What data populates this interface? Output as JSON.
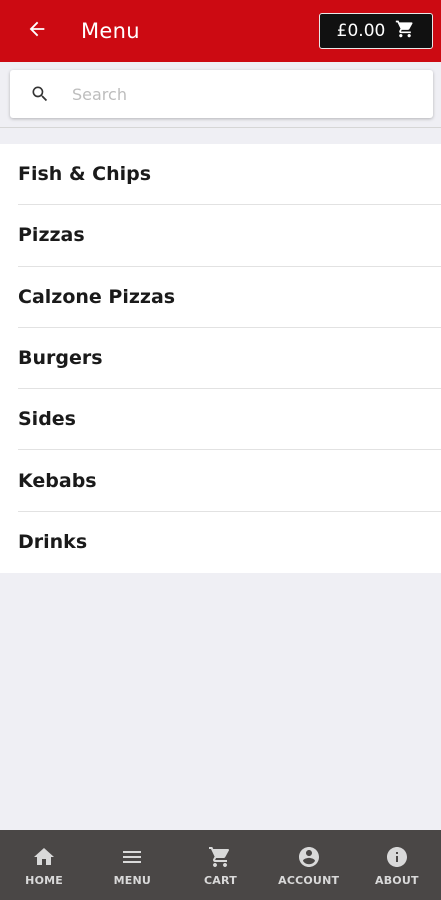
{
  "header": {
    "title": "Menu",
    "cart_total": "£0.00",
    "back_icon": "arrow-left-icon",
    "cart_icon": "cart-icon",
    "background_color": "#cc0a12"
  },
  "search": {
    "placeholder": "Search",
    "value": ""
  },
  "menu": {
    "items": [
      {
        "label": "Fish & Chips"
      },
      {
        "label": "Pizzas"
      },
      {
        "label": "Calzone Pizzas"
      },
      {
        "label": "Burgers"
      },
      {
        "label": "Sides"
      },
      {
        "label": "Kebabs"
      },
      {
        "label": "Drinks"
      }
    ]
  },
  "bottom_nav": {
    "items": [
      {
        "label": "HOME",
        "icon": "home-icon"
      },
      {
        "label": "MENU",
        "icon": "menu-icon"
      },
      {
        "label": "CART",
        "icon": "cart-icon"
      },
      {
        "label": "ACCOUNT",
        "icon": "account-icon"
      },
      {
        "label": "ABOUT",
        "icon": "info-icon"
      }
    ]
  }
}
